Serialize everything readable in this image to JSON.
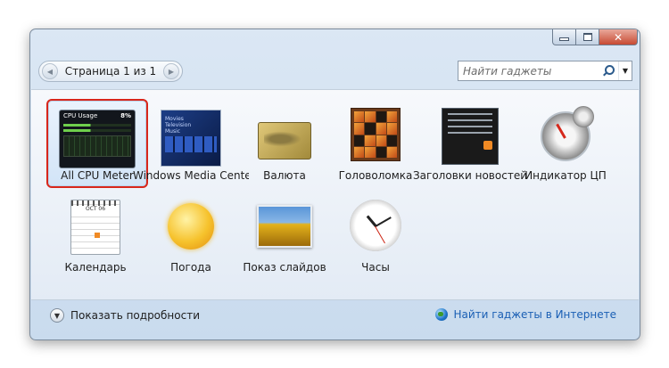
{
  "pager": {
    "label": "Страница 1 из 1",
    "prev_icon": "chevron-left-icon",
    "next_icon": "chevron-right-icon"
  },
  "search": {
    "placeholder": "Найти гаджеты",
    "icon": "search-icon",
    "dropdown_icon": "chevron-down-icon"
  },
  "gadgets": [
    {
      "label": "All CPU Meter",
      "selected": true
    },
    {
      "label": "Windows Media Center"
    },
    {
      "label": "Валюта"
    },
    {
      "label": "Головоломка"
    },
    {
      "label": "Заголовки новостей"
    },
    {
      "label": "Индикатор ЦП"
    },
    {
      "label": "Календарь"
    },
    {
      "label": "Погода"
    },
    {
      "label": "Показ слайдов"
    },
    {
      "label": "Часы"
    }
  ],
  "thumb_text": {
    "cpu_title": "CPU Usage",
    "cpu_percent": "8%",
    "wmc_lines": [
      "Movies",
      "Television",
      "Music"
    ],
    "calendar_month": "OCT 06"
  },
  "footer": {
    "details_label": "Показать подробности",
    "online_label": "Найти гаджеты в Интернете"
  },
  "colors": {
    "selection_border": "#d8261b",
    "link": "#1a5fb4"
  }
}
